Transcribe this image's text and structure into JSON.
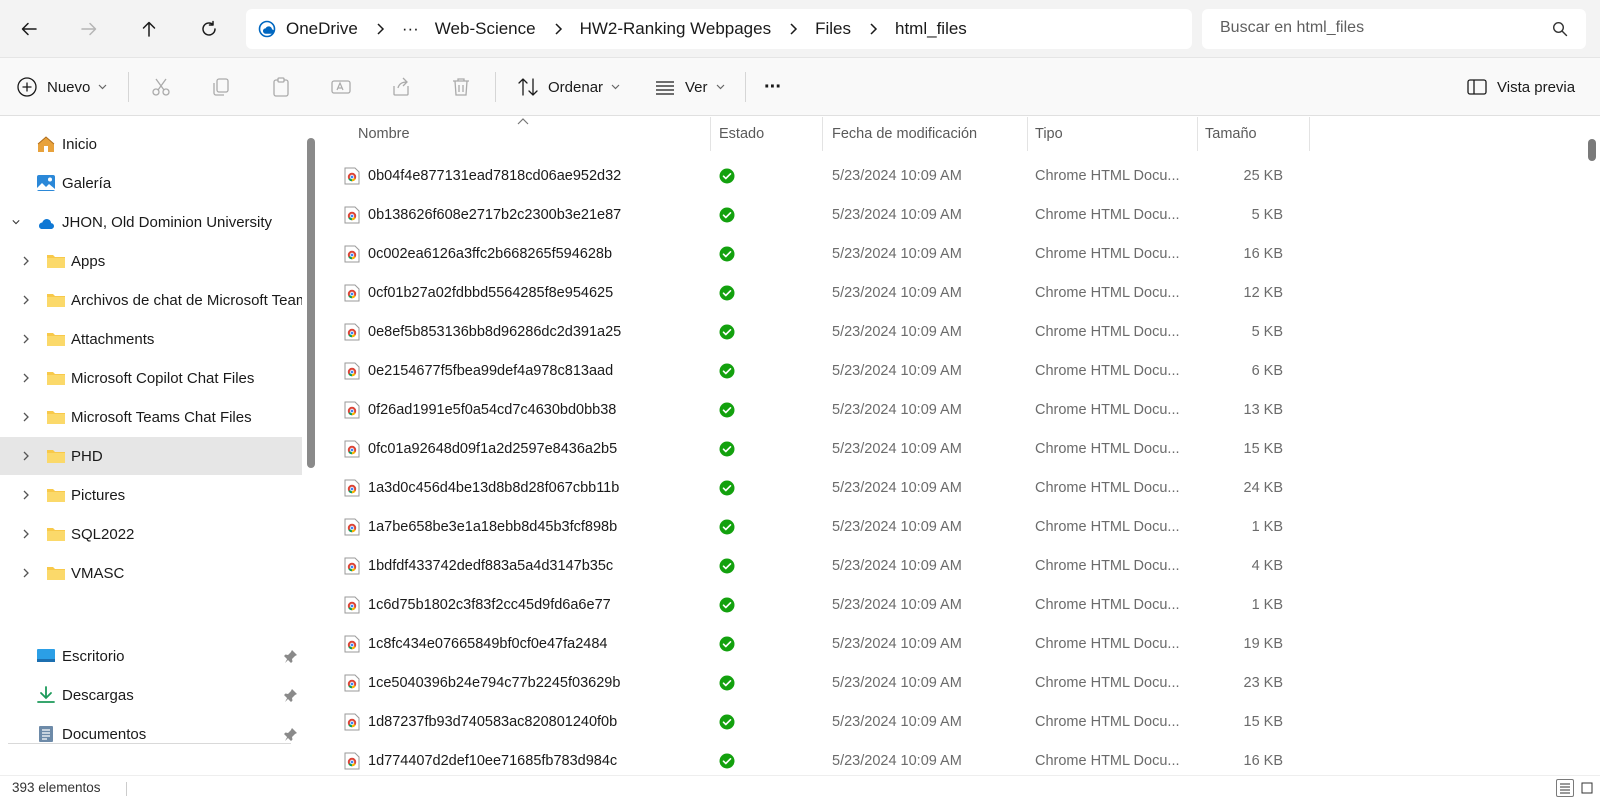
{
  "breadcrumb": [
    {
      "label": "OneDrive"
    },
    {
      "label": "···"
    },
    {
      "label": "Web-Science"
    },
    {
      "label": "HW2-Ranking Webpages"
    },
    {
      "label": "Files"
    },
    {
      "label": "html_files"
    }
  ],
  "search": {
    "placeholder": "Buscar en html_files"
  },
  "toolbar": {
    "new_label": "Nuevo",
    "sort_label": "Ordenar",
    "view_label": "Ver",
    "more_label": "···",
    "preview_label": "Vista previa"
  },
  "sidebar": {
    "top": [
      {
        "label": "Inicio",
        "icon": "home-icon"
      },
      {
        "label": "Galería",
        "icon": "gallery-icon"
      }
    ],
    "account": {
      "label": "JHON, Old Dominion University",
      "icon": "onedrive-cloud-icon"
    },
    "folders": [
      {
        "label": "Apps"
      },
      {
        "label": "Archivos de chat de Microsoft Teams"
      },
      {
        "label": "Attachments"
      },
      {
        "label": "Microsoft Copilot Chat Files"
      },
      {
        "label": "Microsoft Teams Chat Files"
      },
      {
        "label": "PHD",
        "selected": true
      },
      {
        "label": "Pictures"
      },
      {
        "label": "SQL2022"
      },
      {
        "label": "VMASC"
      }
    ],
    "quick": [
      {
        "label": "Escritorio",
        "icon": "desktop-icon"
      },
      {
        "label": "Descargas",
        "icon": "download-icon"
      },
      {
        "label": "Documentos",
        "icon": "documents-icon"
      }
    ]
  },
  "columns": {
    "name": "Nombre",
    "status": "Estado",
    "date": "Fecha de modificación",
    "type": "Tipo",
    "size": "Tamaño"
  },
  "files": [
    {
      "name": "0b04f4e877131ead7818cd06ae952d32",
      "date": "5/23/2024 10:09 AM",
      "type": "Chrome HTML Docu...",
      "size": "25 KB"
    },
    {
      "name": "0b138626f608e2717b2c2300b3e21e87",
      "date": "5/23/2024 10:09 AM",
      "type": "Chrome HTML Docu...",
      "size": "5 KB"
    },
    {
      "name": "0c002ea6126a3ffc2b668265f594628b",
      "date": "5/23/2024 10:09 AM",
      "type": "Chrome HTML Docu...",
      "size": "16 KB"
    },
    {
      "name": "0cf01b27a02fdbbd5564285f8e954625",
      "date": "5/23/2024 10:09 AM",
      "type": "Chrome HTML Docu...",
      "size": "12 KB"
    },
    {
      "name": "0e8ef5b853136bb8d96286dc2d391a25",
      "date": "5/23/2024 10:09 AM",
      "type": "Chrome HTML Docu...",
      "size": "5 KB"
    },
    {
      "name": "0e2154677f5fbea99def4a978c813aad",
      "date": "5/23/2024 10:09 AM",
      "type": "Chrome HTML Docu...",
      "size": "6 KB"
    },
    {
      "name": "0f26ad1991e5f0a54cd7c4630bd0bb38",
      "date": "5/23/2024 10:09 AM",
      "type": "Chrome HTML Docu...",
      "size": "13 KB"
    },
    {
      "name": "0fc01a92648d09f1a2d2597e8436a2b5",
      "date": "5/23/2024 10:09 AM",
      "type": "Chrome HTML Docu...",
      "size": "15 KB"
    },
    {
      "name": "1a3d0c456d4be13d8b8d28f067cbb11b",
      "date": "5/23/2024 10:09 AM",
      "type": "Chrome HTML Docu...",
      "size": "24 KB"
    },
    {
      "name": "1a7be658be3e1a18ebb8d45b3fcf898b",
      "date": "5/23/2024 10:09 AM",
      "type": "Chrome HTML Docu...",
      "size": "1 KB"
    },
    {
      "name": "1bdfdf433742dedf883a5a4d3147b35c",
      "date": "5/23/2024 10:09 AM",
      "type": "Chrome HTML Docu...",
      "size": "4 KB"
    },
    {
      "name": "1c6d75b1802c3f83f2cc45d9fd6a6e77",
      "date": "5/23/2024 10:09 AM",
      "type": "Chrome HTML Docu...",
      "size": "1 KB"
    },
    {
      "name": "1c8fc434e07665849bf0cf0e47fa2484",
      "date": "5/23/2024 10:09 AM",
      "type": "Chrome HTML Docu...",
      "size": "19 KB"
    },
    {
      "name": "1ce5040396b24e794c77b2245f03629b",
      "date": "5/23/2024 10:09 AM",
      "type": "Chrome HTML Docu...",
      "size": "23 KB"
    },
    {
      "name": "1d87237fb93d740583ac820801240f0b",
      "date": "5/23/2024 10:09 AM",
      "type": "Chrome HTML Docu...",
      "size": "15 KB"
    },
    {
      "name": "1d774407d2def10ee71685fb783d984c",
      "date": "5/23/2024 10:09 AM",
      "type": "Chrome HTML Docu...",
      "size": "16 KB"
    }
  ],
  "status_bar": {
    "item_count": "393 elementos"
  },
  "colors": {
    "synced_green": "#13a10e",
    "accent_blue": "#0067c0",
    "folder_yellow": "#f8c94a",
    "selected_row": "#e6e6e6"
  }
}
